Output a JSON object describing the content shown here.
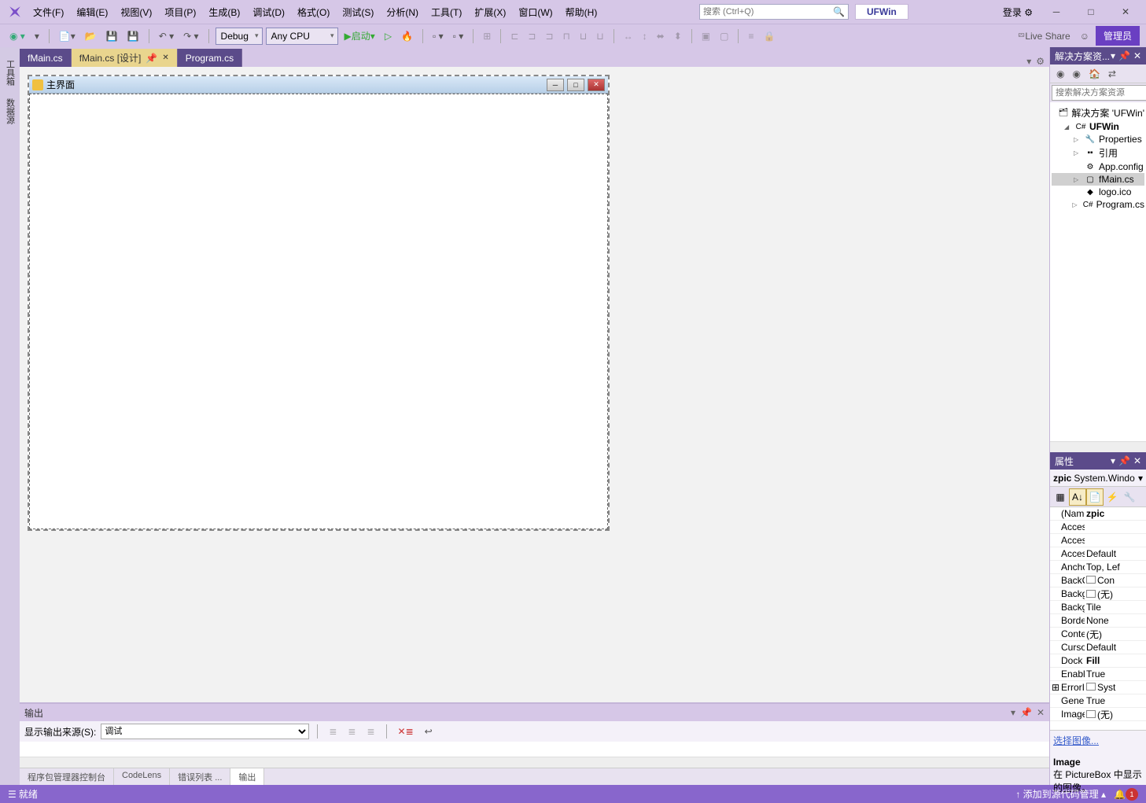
{
  "menu": {
    "file": "文件(F)",
    "edit": "编辑(E)",
    "view": "视图(V)",
    "project": "项目(P)",
    "build": "生成(B)",
    "debug": "调试(D)",
    "format": "格式(O)",
    "test": "测试(S)",
    "analyze": "分析(N)",
    "tools": "工具(T)",
    "extensions": "扩展(X)",
    "window": "窗口(W)",
    "help": "帮助(H)"
  },
  "search": {
    "placeholder": "搜索 (Ctrl+Q)"
  },
  "solution_name": "UFWin",
  "titlebar": {
    "login": "登录"
  },
  "toolbar": {
    "config": "Debug",
    "platform": "Any CPU",
    "start": "启动",
    "liveshare": "Live Share",
    "admin": "管理员"
  },
  "left_tabs": {
    "toolbox": "工具箱",
    "datasources": "数据源"
  },
  "doc_tabs": [
    {
      "label": "fMain.cs",
      "active": false
    },
    {
      "label": "fMain.cs [设计]",
      "active": true,
      "pinned": true
    },
    {
      "label": "Program.cs",
      "active": false
    }
  ],
  "form": {
    "title": "主界面"
  },
  "solution_explorer": {
    "title": "解决方案资...",
    "search_placeholder": "搜索解决方案资源",
    "nodes": [
      {
        "indent": 0,
        "exp": "",
        "icon": "🗂",
        "label": "解决方案 'UFWin'",
        "sel": false
      },
      {
        "indent": 1,
        "exp": "◢",
        "icon": "C#",
        "label": "UFWin",
        "bold": true,
        "sel": false
      },
      {
        "indent": 2,
        "exp": "▷",
        "icon": "🔧",
        "label": "Properties",
        "sel": false
      },
      {
        "indent": 2,
        "exp": "▷",
        "icon": "▪▪",
        "label": "引用",
        "sel": false
      },
      {
        "indent": 2,
        "exp": "",
        "icon": "⚙",
        "label": "App.config",
        "sel": false
      },
      {
        "indent": 2,
        "exp": "▷",
        "icon": "▢",
        "label": "fMain.cs",
        "sel": true
      },
      {
        "indent": 2,
        "exp": "",
        "icon": "◆",
        "label": "logo.ico",
        "sel": false
      },
      {
        "indent": 2,
        "exp": "▷",
        "icon": "C#",
        "label": "Program.cs",
        "sel": false
      }
    ]
  },
  "properties": {
    "title": "属性",
    "object_name": "zpic",
    "object_type": "System.Windo",
    "rows": [
      {
        "name": "(Name)",
        "value": "zpic",
        "bold": true
      },
      {
        "name": "Accessil",
        "value": ""
      },
      {
        "name": "Accessil",
        "value": ""
      },
      {
        "name": "Accessil",
        "value": "Default"
      },
      {
        "name": "Anchor",
        "value": "Top, Lef"
      },
      {
        "name": "BackCo",
        "value": "Con",
        "swatch": true
      },
      {
        "name": "Backgro",
        "value": "(无)",
        "swatch": true
      },
      {
        "name": "Backgro",
        "value": "Tile"
      },
      {
        "name": "BorderS",
        "value": "None"
      },
      {
        "name": "Context",
        "value": "(无)"
      },
      {
        "name": "Cursor",
        "value": "Default"
      },
      {
        "name": "Dock",
        "value": "Fill",
        "bold": true
      },
      {
        "name": "Enablec",
        "value": "True"
      },
      {
        "name": "ErrorIm",
        "value": "Syst",
        "swatch": true,
        "expander": true
      },
      {
        "name": "Genera",
        "value": "True"
      },
      {
        "name": "Image",
        "value": "(无)",
        "swatch": true
      }
    ],
    "link": "选择图像...",
    "desc_title": "Image",
    "desc_body": "在 PictureBox 中显示的图像。"
  },
  "output": {
    "title": "输出",
    "source_label": "显示输出来源(S):",
    "source_value": "调试",
    "tabs": [
      "程序包管理器控制台",
      "CodeLens",
      "错误列表 ...",
      "输出"
    ]
  },
  "statusbar": {
    "ready": "就绪",
    "scm": "添加到源代码管理",
    "notif": "1"
  }
}
